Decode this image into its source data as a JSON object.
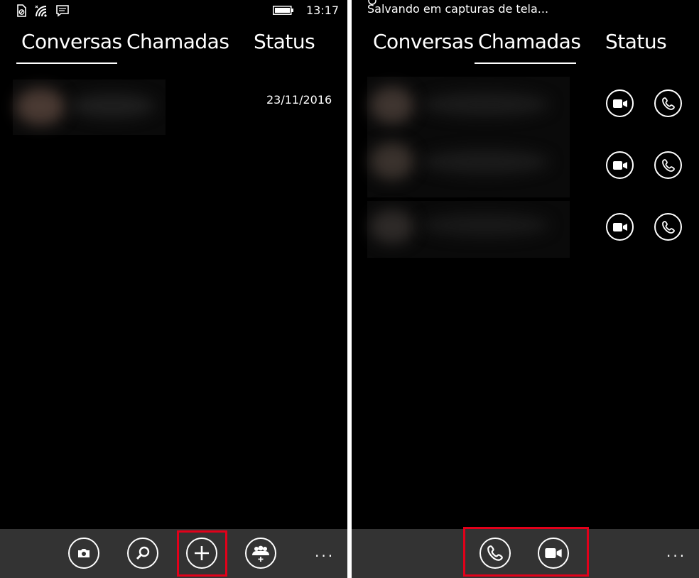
{
  "left": {
    "status": {
      "time": "13:17"
    },
    "tabs": [
      {
        "label": "Conversas",
        "active": true
      },
      {
        "label": "Chamadas",
        "active": false
      },
      {
        "label": "Status",
        "active": false
      }
    ],
    "conversations": [
      {
        "date": "23/11/2016"
      }
    ],
    "appbar": {
      "buttons": [
        "camera-icon",
        "search-icon",
        "plus-icon",
        "group-add-icon"
      ],
      "more_label": "..."
    }
  },
  "right": {
    "toast": "Salvando em capturas de tela...",
    "tabs": [
      {
        "label": "Conversas",
        "active": false
      },
      {
        "label": "Chamadas",
        "active": true
      },
      {
        "label": "Status",
        "active": false
      }
    ],
    "calls": [
      {
        "actions": [
          "video-call-icon",
          "phone-icon"
        ]
      },
      {
        "actions": [
          "video-call-icon",
          "phone-icon"
        ]
      },
      {
        "actions": [
          "video-call-icon",
          "phone-icon"
        ]
      }
    ],
    "appbar": {
      "buttons": [
        "phone-icon",
        "video-call-icon"
      ],
      "more_label": "..."
    }
  },
  "colors": {
    "background": "#000000",
    "appbar": "#333333",
    "foreground": "#ffffff",
    "highlight": "#e2001a"
  }
}
